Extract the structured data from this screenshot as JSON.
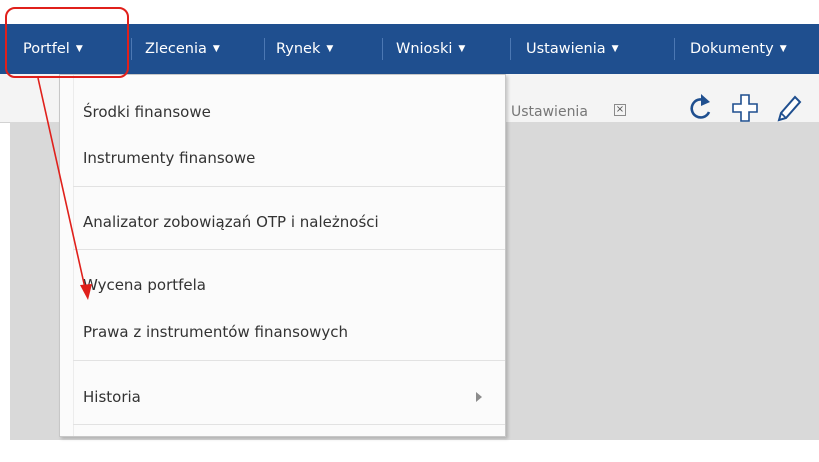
{
  "navbar": {
    "items": [
      {
        "label": "Portfel"
      },
      {
        "label": "Zlecenia"
      },
      {
        "label": "Rynek"
      },
      {
        "label": "Wnioski"
      },
      {
        "label": "Ustawienia"
      },
      {
        "label": "Dokumenty"
      }
    ],
    "caret": "▼"
  },
  "tab": {
    "label": "Ustawienia",
    "close_glyph": "×"
  },
  "toolbar": {
    "icons": [
      "refresh-icon",
      "add-icon",
      "edit-icon"
    ]
  },
  "dropdown": {
    "items": [
      {
        "label": "Środki finansowe"
      },
      {
        "label": "Instrumenty finansowe"
      },
      {
        "label": "Analizator zobowiązań OTP i należności"
      },
      {
        "label": "Wycena portfela"
      },
      {
        "label": "Prawa z instrumentów finansowych"
      },
      {
        "label": "Historia",
        "has_submenu": true
      }
    ]
  },
  "colors": {
    "navbar": "#1f4f8f",
    "annotation": "#e0201b"
  }
}
